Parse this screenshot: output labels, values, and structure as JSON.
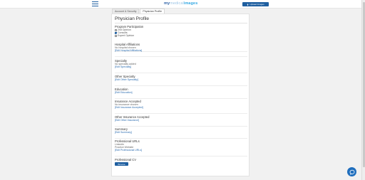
{
  "header": {
    "logo_part1": "my",
    "logo_part2": "medical",
    "logo_part3": "images",
    "upload_label": "Upload Images",
    "menu_icon": "hamburger-menu-icon"
  },
  "tabs": [
    {
      "label": "Account & Security",
      "active": false
    },
    {
      "label": "Physician Profile",
      "active": true
    }
  ],
  "profile": {
    "title": "Physician Profile",
    "program_participation": {
      "heading": "Program Participation",
      "options": [
        {
          "label": "2nd Opinion",
          "checked": false
        },
        {
          "label": "Consults",
          "checked": true
        },
        {
          "label": "Expert Opinion",
          "checked": false
        }
      ]
    },
    "hospital_affiliations": {
      "heading": "Hospital Affiliations",
      "text": "No hospital chosen",
      "link": "[Edit Hospital Affiliations]"
    },
    "specialty": {
      "heading": "Specialty",
      "text": "No specialty added",
      "link": "[Edit Specialty]"
    },
    "other_specialty": {
      "heading": "Other Specialty",
      "link": "[Edit Other Specialty]"
    },
    "education": {
      "heading": "Education",
      "link": "[Edit Education]"
    },
    "insurance_accepted": {
      "heading": "Insurance Accepted",
      "text": "No insurance chosen",
      "link": "[Edit Insurance Accepted]"
    },
    "other_insurance": {
      "heading": "Other Insurance Accepted",
      "link": "[Edit Other Insurance]"
    },
    "summary": {
      "heading": "Summary",
      "link": "[Edit Summary]"
    },
    "professional_urls": {
      "heading": "Professional URLs",
      "items": [
        "LinkedIn",
        "Practice Website"
      ],
      "link": "[Edit Professional URLs]"
    },
    "professional_cv": {
      "heading": "Professional CV",
      "button": "Browse"
    }
  },
  "chat": {
    "icon": "chat-bubble-icon"
  },
  "colors": {
    "primary": "#1f5fa0",
    "link": "#2b6cb0",
    "background": "#f1f1f1"
  }
}
